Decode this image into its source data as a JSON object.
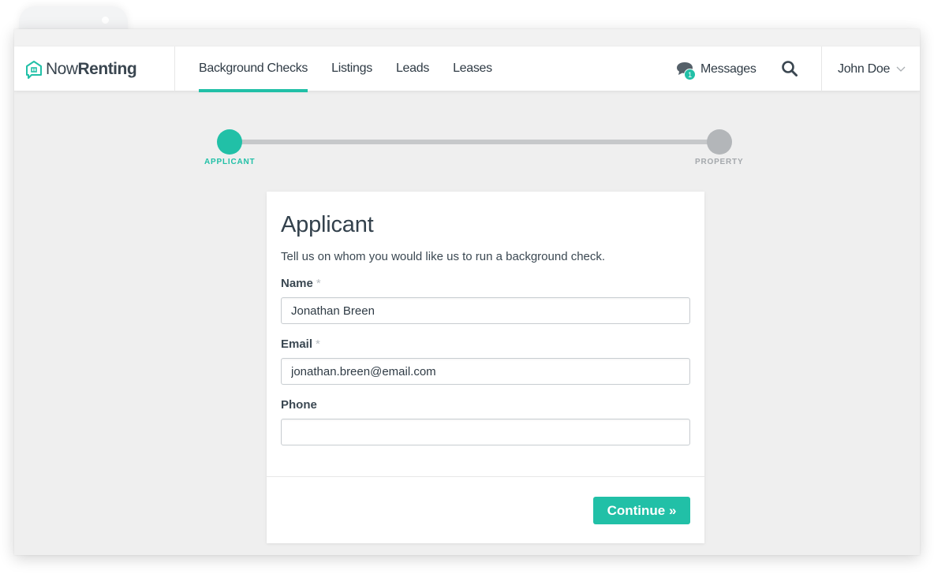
{
  "brand": {
    "name_light": "Now",
    "name_bold": "Renting"
  },
  "nav": {
    "links": [
      {
        "label": "Background Checks",
        "active": true
      },
      {
        "label": "Listings",
        "active": false
      },
      {
        "label": "Leads",
        "active": false
      },
      {
        "label": "Leases",
        "active": false
      }
    ],
    "messages_label": "Messages",
    "messages_badge": "1",
    "user_name": "John Doe"
  },
  "stepper": {
    "steps": [
      {
        "label": "APPLICANT",
        "state": "current"
      },
      {
        "label": "PROPERTY",
        "state": "upcoming"
      }
    ]
  },
  "form": {
    "title": "Applicant",
    "description": "Tell us on whom you would like us to run a background check.",
    "fields": [
      {
        "label": "Name",
        "required_mark": "*",
        "value": "Jonathan Breen"
      },
      {
        "label": "Email",
        "required_mark": "*",
        "value": "jonathan.breen@email.com"
      },
      {
        "label": "Phone",
        "required_mark": "",
        "value": ""
      }
    ],
    "continue_label": "Continue »"
  },
  "colors": {
    "accent": "#21c0a7",
    "inactive_step": "#b3b6b9",
    "background": "#efefef"
  }
}
